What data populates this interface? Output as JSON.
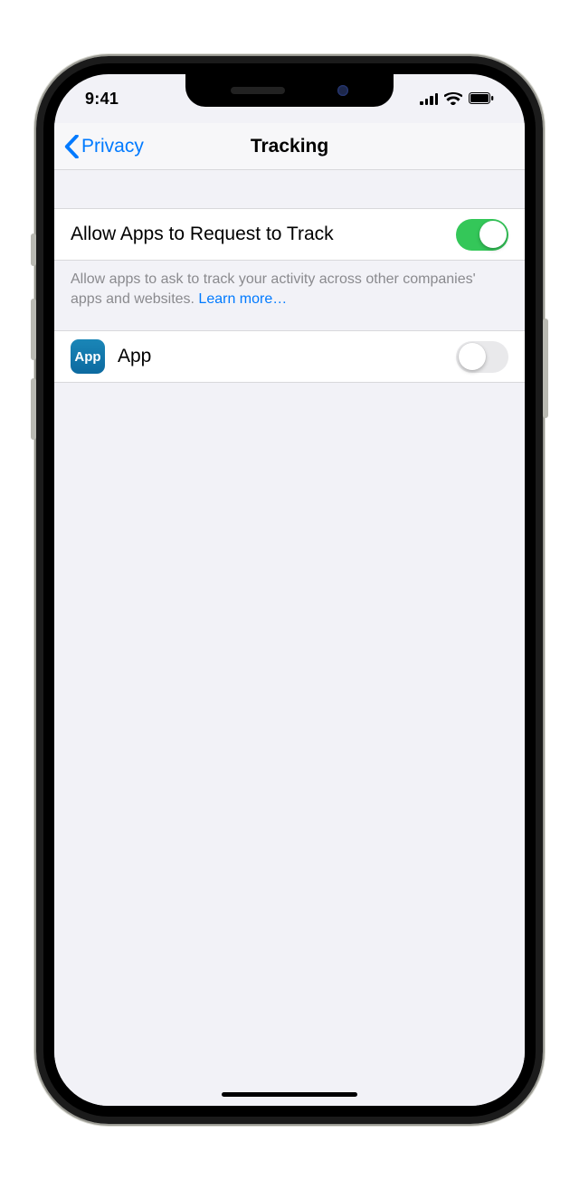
{
  "statusbar": {
    "time": "9:41"
  },
  "nav": {
    "back_label": "Privacy",
    "title": "Tracking"
  },
  "settings": {
    "allow_request": {
      "label": "Allow Apps to Request to Track",
      "on": true,
      "footer_pre": "Allow apps to ask to track your activity across other companies' apps and websites. ",
      "learn_more": "Learn more…"
    },
    "apps": [
      {
        "name": "App",
        "icon_text": "App",
        "tracking_on": false
      }
    ]
  }
}
